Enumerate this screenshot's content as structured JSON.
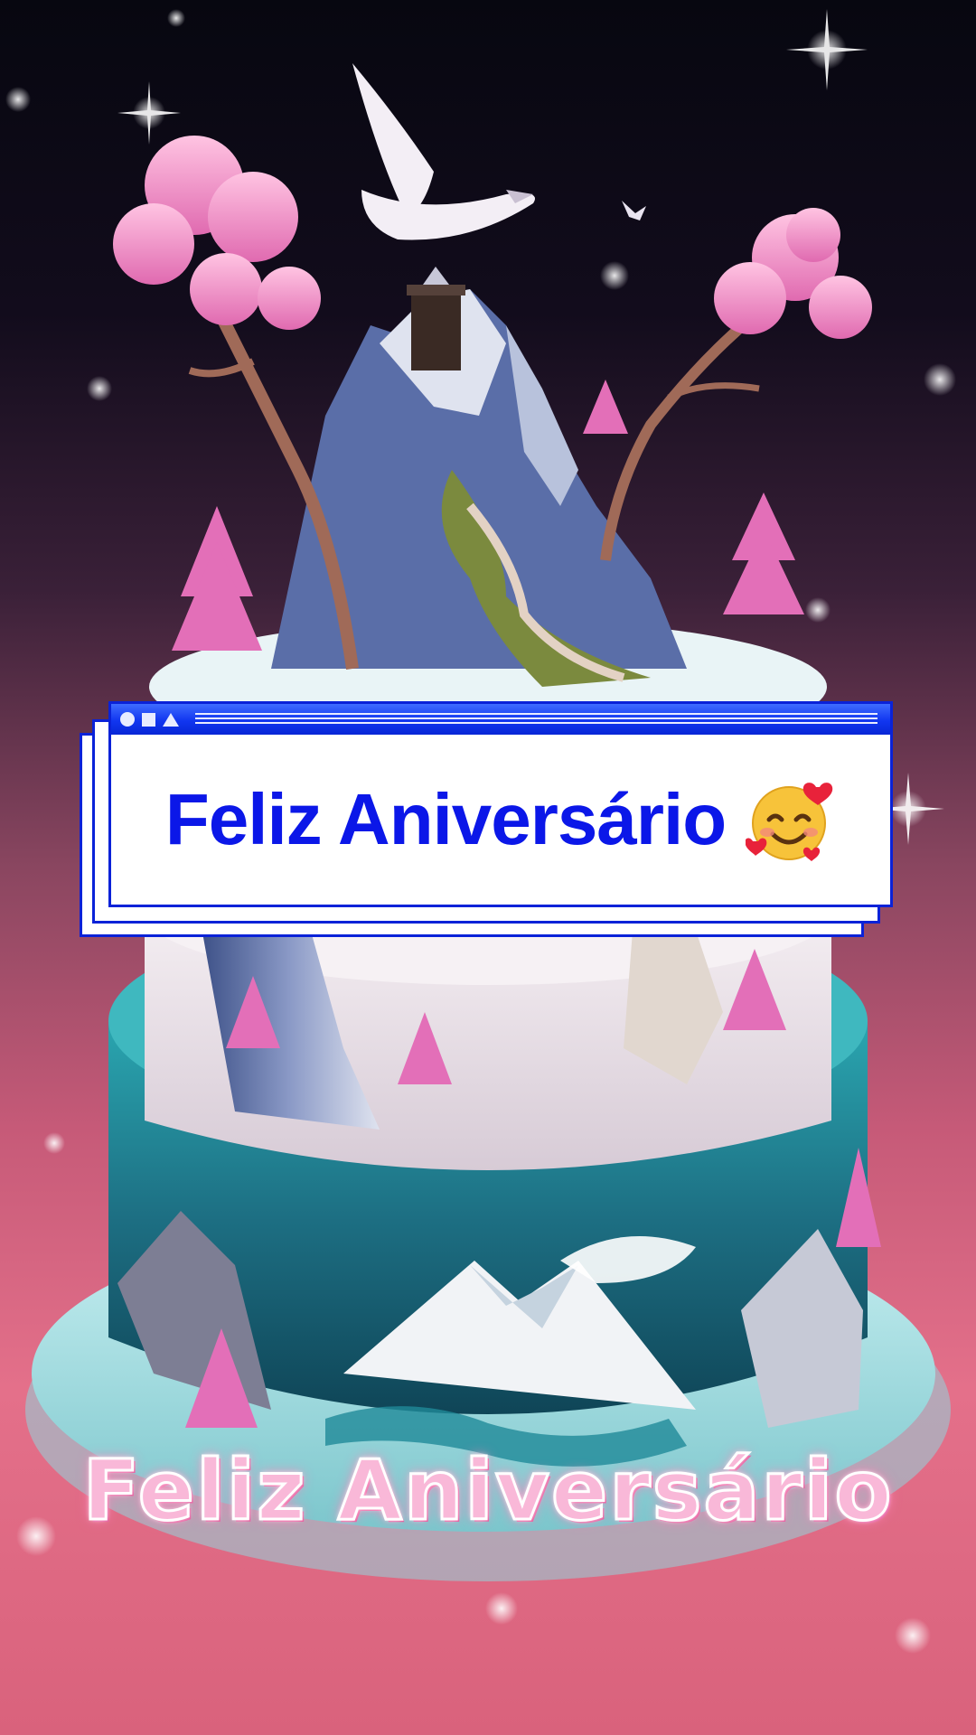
{
  "title_window": {
    "title": "Feliz Aniversário",
    "emoji": "smiling-face-with-hearts-icon",
    "accent_color": "#0b17e8"
  },
  "caption": {
    "text": "Feliz Aniversário",
    "color": "#f9b8d8"
  },
  "background": {
    "top_color": "#070710",
    "bottom_color": "#e4708a"
  }
}
